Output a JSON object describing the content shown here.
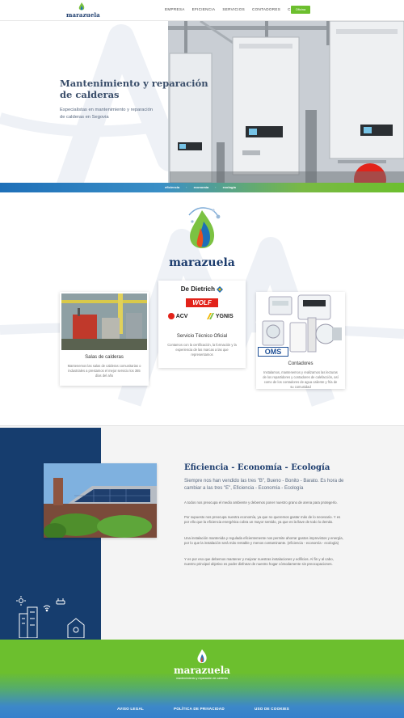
{
  "header": {
    "brand": "marazuela",
    "nav": [
      "EMPRESA",
      "EFICIENCIA",
      "SERVICIOS",
      "CONTADORES",
      "CONTACTO"
    ],
    "cta": "Oficina"
  },
  "hero": {
    "title": "Mantenimiento y reparación de calderas",
    "subtitle": "Especialistas en mantenimiento y reparación de calderas en Segovia"
  },
  "strip": [
    "eficiencia",
    "economía",
    "ecología"
  ],
  "brand": {
    "name": "marazuela"
  },
  "services": [
    {
      "title": "Salas de calderas",
      "text": "Mantenemos las salas de calderas comunitarias o industriales a prestamos el mejor servicio los 365 días del año"
    },
    {
      "title": "Servicio Técnico Oficial",
      "text": "Contamos con la certificación, la formación y la experiencia de las marcas a las que representamos",
      "brands": [
        "De Dietrich",
        "WOLF",
        "ACV",
        "YGNIS"
      ]
    },
    {
      "title": "Contadores",
      "text": "Instalamos, mantenemos y realizamos las lecturas de los repartidores y contadores de calefacción, así como de los contadores de agua caliente y fría de su comunidad",
      "badge": "OMS"
    }
  ],
  "eco": {
    "title": "Eficiencia - Economía - Ecología",
    "lead": "Siempre nos han vendido las tres \"B\", Bueno - Bonito - Barato. Es hora de cambiar a las tres \"E\", Eficiencia - Economía - Ecología",
    "paragraphs": [
      "A todos nos preocupa el medio ambiente y debemos poner nuestro grano de arena para protegerlo.",
      "Por supuesto nos preocupa nuestra economía, ya que no queremos gastar más de lo necesario. Y es por ello que la eficiencia energética cobra un mayor sentido, ya que es la llave de todo lo demás.",
      "Una instalación mantenida y regulada eficientemente nos permite ahorrar gastos imprevistos y energía, por lo que la instalación será más rentable y menos contaminante. (eficiencia - economía - ecología)",
      "Y es por eso que debemos mantener y mejorar nuestras instalaciones y edificios. Al fin y al cabo, nuestro principal objetivo es poder disfrutar de nuestro hogar cómodamente sin preocupaciones."
    ]
  },
  "footer": {
    "brand": "marazuela",
    "tagline": "mantenimiento y reparación de calderas",
    "links": [
      "AVISO LEGAL",
      "POLÍTICA DE PRIVACIDAD",
      "USO DE COOKIES"
    ]
  },
  "colors": {
    "navy": "#163d6e",
    "green": "#6cbf2e",
    "blue": "#3680cc",
    "brand_text": "#1d3d6e"
  },
  "icons": [
    "flame-logo-icon",
    "sun-icon",
    "wifi-icon",
    "building-icon",
    "house-icon"
  ]
}
